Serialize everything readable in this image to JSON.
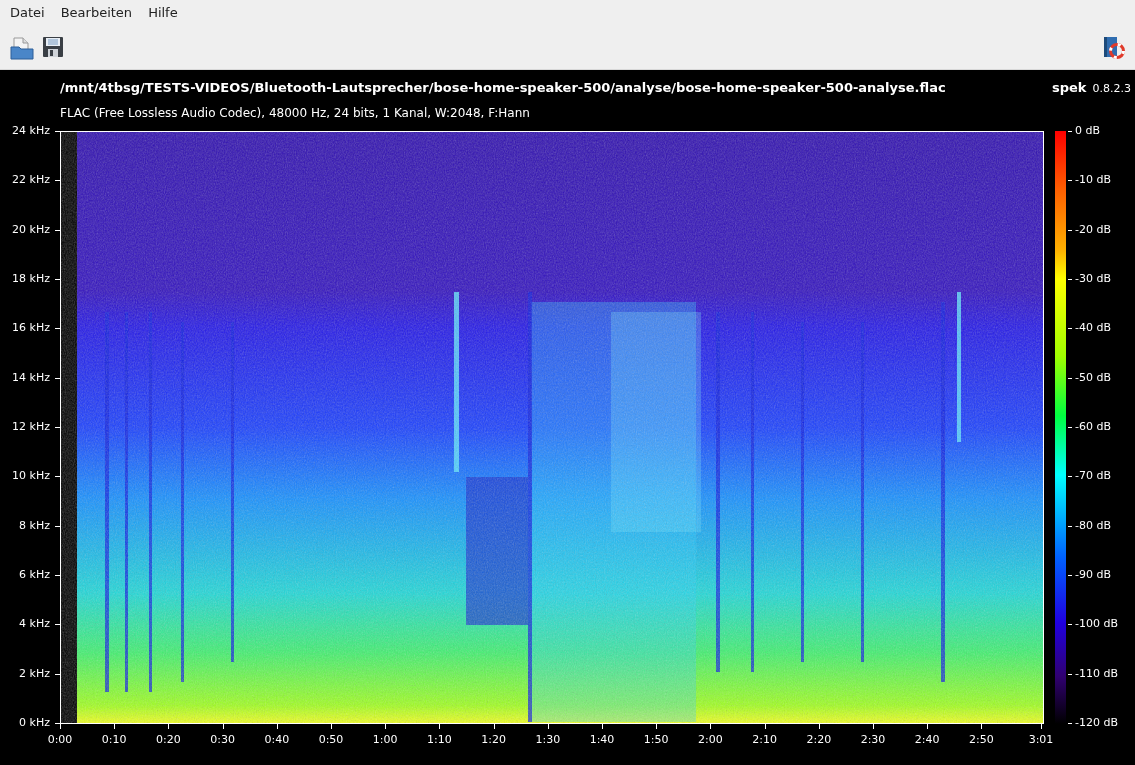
{
  "menu": [
    "Datei",
    "Bearbeiten",
    "Hilfe"
  ],
  "file_path": "/mnt/4tbsg/TESTS-VIDEOS/Bluetooth-Lautsprecher/bose-home-speaker-500/analyse/bose-home-speaker-500-analyse.flac",
  "app_name": "spek",
  "app_version": "0.8.2.3",
  "file_info": "FLAC (Free Lossless Audio Codec), 48000 Hz, 24 bits, 1 Kanal, W:2048, F:Hann",
  "frequency_labels": [
    "24 kHz",
    "22 kHz",
    "20 kHz",
    "18 kHz",
    "16 kHz",
    "14 kHz",
    "12 kHz",
    "10 kHz",
    "8 kHz",
    "6 kHz",
    "4 kHz",
    "2 kHz",
    "0 kHz"
  ],
  "time_labels": [
    "0:00",
    "0:10",
    "0:20",
    "0:30",
    "0:40",
    "0:50",
    "1:00",
    "1:10",
    "1:20",
    "1:30",
    "1:40",
    "1:50",
    "2:00",
    "2:10",
    "2:20",
    "2:30",
    "2:40",
    "2:50",
    "3:01"
  ],
  "legend_labels": [
    "0 dB",
    "-10 dB",
    "-20 dB",
    "-30 dB",
    "-40 dB",
    "-50 dB",
    "-60 dB",
    "-70 dB",
    "-80 dB",
    "-90 dB",
    "-100 dB",
    "-110 dB",
    "-120 dB"
  ]
}
